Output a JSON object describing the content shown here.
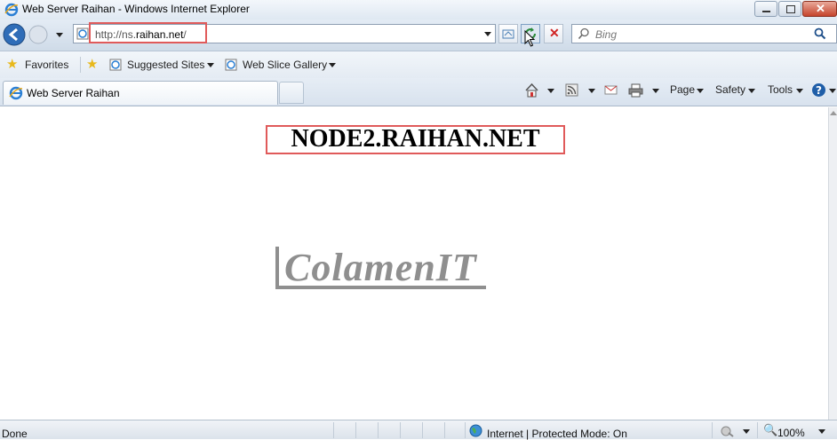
{
  "window": {
    "title": "Web Server Raihan - Windows Internet Explorer"
  },
  "address": {
    "url_prefix": "http://ns.",
    "url_domain": "raihan.net",
    "url_suffix": "/"
  },
  "search": {
    "placeholder": "Bing"
  },
  "favorites": {
    "favorites_label": "Favorites",
    "items": [
      {
        "label": "Suggested Sites"
      },
      {
        "label": "Web Slice Gallery"
      }
    ]
  },
  "tab": {
    "label": "Web Server Raihan"
  },
  "commandbar": {
    "page_label": "Page",
    "safety_label": "Safety",
    "tools_label": "Tools"
  },
  "content": {
    "heading": "NODE2.RAIHAN.NET",
    "logo_text": "ColamenIT"
  },
  "status": {
    "left_text": "Done",
    "zone_text": "Internet | Protected Mode: On",
    "zoom_text": "100%"
  },
  "colors": {
    "highlight": "#e05a5a",
    "logo_gray": "#8f8f8f"
  }
}
